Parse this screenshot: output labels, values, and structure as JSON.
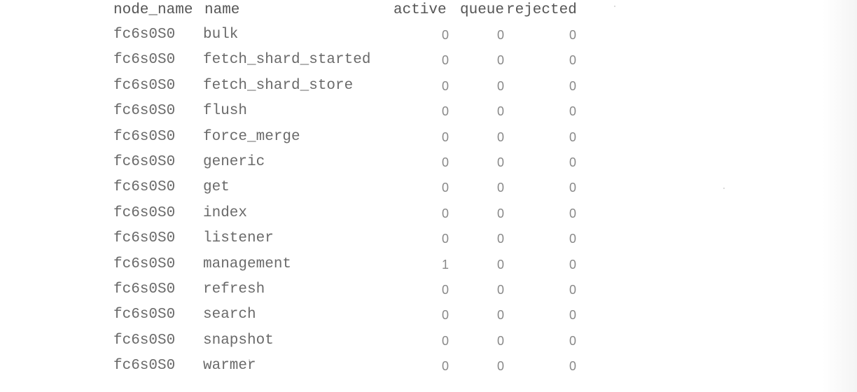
{
  "table": {
    "headers": {
      "node_name": "node_name",
      "name": "name",
      "active": "active",
      "queue": "queue",
      "rejected": "rejected"
    },
    "rows": [
      {
        "node_name": "fc6s0S0",
        "name": "bulk",
        "active": "0",
        "queue": "0",
        "rejected": "0"
      },
      {
        "node_name": "fc6s0S0",
        "name": "fetch_shard_started",
        "active": "0",
        "queue": "0",
        "rejected": "0"
      },
      {
        "node_name": "fc6s0S0",
        "name": "fetch_shard_store",
        "active": "0",
        "queue": "0",
        "rejected": "0"
      },
      {
        "node_name": "fc6s0S0",
        "name": "flush",
        "active": "0",
        "queue": "0",
        "rejected": "0"
      },
      {
        "node_name": "fc6s0S0",
        "name": "force_merge",
        "active": "0",
        "queue": "0",
        "rejected": "0"
      },
      {
        "node_name": "fc6s0S0",
        "name": "generic",
        "active": "0",
        "queue": "0",
        "rejected": "0"
      },
      {
        "node_name": "fc6s0S0",
        "name": "get",
        "active": "0",
        "queue": "0",
        "rejected": "0"
      },
      {
        "node_name": "fc6s0S0",
        "name": "index",
        "active": "0",
        "queue": "0",
        "rejected": "0"
      },
      {
        "node_name": "fc6s0S0",
        "name": "listener",
        "active": "0",
        "queue": "0",
        "rejected": "0"
      },
      {
        "node_name": "fc6s0S0",
        "name": "management",
        "active": "1",
        "queue": "0",
        "rejected": "0"
      },
      {
        "node_name": "fc6s0S0",
        "name": "refresh",
        "active": "0",
        "queue": "0",
        "rejected": "0"
      },
      {
        "node_name": "fc6s0S0",
        "name": "search",
        "active": "0",
        "queue": "0",
        "rejected": "0"
      },
      {
        "node_name": "fc6s0S0",
        "name": "snapshot",
        "active": "0",
        "queue": "0",
        "rejected": "0"
      },
      {
        "node_name": "fc6s0S0",
        "name": "warmer",
        "active": "0",
        "queue": "0",
        "rejected": "0"
      }
    ]
  }
}
